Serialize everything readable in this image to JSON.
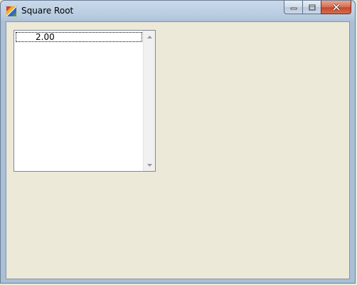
{
  "window": {
    "title": "Square Root",
    "icon": "app-icon",
    "controls": {
      "minimize": "minimize-icon",
      "maximize": "maximize-icon",
      "close": "close-icon"
    }
  },
  "listbox": {
    "items": [
      "2.00"
    ],
    "selected_index": 0
  },
  "colors": {
    "client_background": "#ece9d8",
    "listbox_background": "#ffffff",
    "close_button": "#c54a2d"
  }
}
